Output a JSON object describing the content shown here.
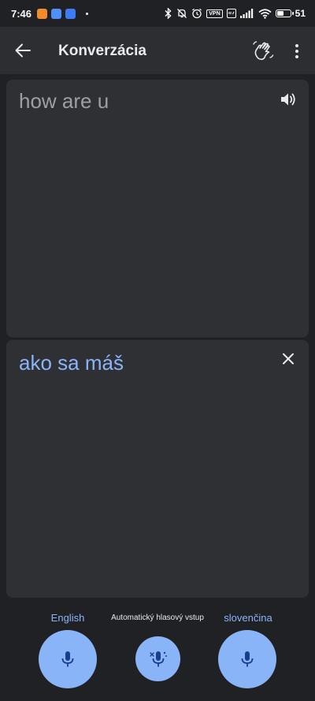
{
  "status_bar": {
    "time": "7:46",
    "battery_text": "51",
    "battery_level": 0.51,
    "vpn_label": "VPN"
  },
  "app_bar": {
    "title": "Konverzácia",
    "back_icon": "arrow-left-icon",
    "wave_icon": "waving-hand-icon",
    "more_icon": "more-vert-icon"
  },
  "source_panel": {
    "text": "how are u",
    "speaker_icon": "volume-icon"
  },
  "target_panel": {
    "text": "ako sa máš",
    "close_icon": "close-icon"
  },
  "controls": {
    "left_language": "English",
    "auto_label": "Automatický hlasový vstup",
    "right_language": "slovenčina"
  },
  "colors": {
    "background": "#202124",
    "panel": "#2f3033",
    "app_bar": "#2d2e31",
    "accent": "#8ab4f8",
    "mic_icon": "#1a3d8f"
  }
}
